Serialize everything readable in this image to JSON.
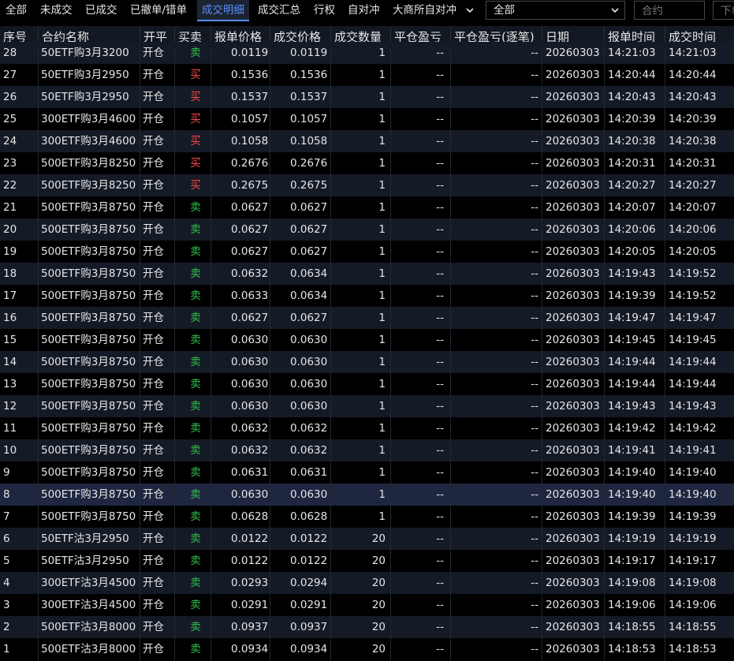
{
  "tabs": [
    {
      "label": "全部"
    },
    {
      "label": "未成交"
    },
    {
      "label": "已成交"
    },
    {
      "label": "已撤单/错单"
    },
    {
      "label": "成交明细",
      "active": true
    },
    {
      "label": "成交汇总"
    },
    {
      "label": "行权"
    },
    {
      "label": "自对冲"
    },
    {
      "label": "大商所自对冲"
    }
  ],
  "filter": {
    "selected": "全部"
  },
  "search": {
    "placeholder": "合约"
  },
  "search2": {
    "placeholder": "下单"
  },
  "columns": [
    "序号",
    "合约名称",
    "开平",
    "买卖",
    "报单价格",
    "成交价格",
    "成交数量",
    "平仓盈亏",
    "平仓盈亏(逐笔)",
    "日期",
    "报单时间",
    "成交时间"
  ],
  "colors": {
    "buy": "#ff4545",
    "sell": "#2fc24b",
    "accent": "#5b8ff9"
  },
  "rows": [
    {
      "no": "28",
      "name": "50ETF购3月3200",
      "oc": "开仓",
      "side": "卖",
      "order_price": "0.0119",
      "trade_price": "0.0119",
      "qty": "1",
      "pnl": "--",
      "pnl_each": "--",
      "date": "20260303",
      "order_time": "14:21:03",
      "trade_time": "14:21:03"
    },
    {
      "no": "27",
      "name": "50ETF购3月2950",
      "oc": "开仓",
      "side": "买",
      "order_price": "0.1536",
      "trade_price": "0.1536",
      "qty": "1",
      "pnl": "--",
      "pnl_each": "--",
      "date": "20260303",
      "order_time": "14:20:44",
      "trade_time": "14:20:44"
    },
    {
      "no": "26",
      "name": "50ETF购3月2950",
      "oc": "开仓",
      "side": "买",
      "order_price": "0.1537",
      "trade_price": "0.1537",
      "qty": "1",
      "pnl": "--",
      "pnl_each": "--",
      "date": "20260303",
      "order_time": "14:20:43",
      "trade_time": "14:20:43"
    },
    {
      "no": "25",
      "name": "300ETF购3月4600",
      "oc": "开仓",
      "side": "买",
      "order_price": "0.1057",
      "trade_price": "0.1057",
      "qty": "1",
      "pnl": "--",
      "pnl_each": "--",
      "date": "20260303",
      "order_time": "14:20:39",
      "trade_time": "14:20:39"
    },
    {
      "no": "24",
      "name": "300ETF购3月4600",
      "oc": "开仓",
      "side": "买",
      "order_price": "0.1058",
      "trade_price": "0.1058",
      "qty": "1",
      "pnl": "--",
      "pnl_each": "--",
      "date": "20260303",
      "order_time": "14:20:38",
      "trade_time": "14:20:38"
    },
    {
      "no": "23",
      "name": "500ETF购3月8250",
      "oc": "开仓",
      "side": "买",
      "order_price": "0.2676",
      "trade_price": "0.2676",
      "qty": "1",
      "pnl": "--",
      "pnl_each": "--",
      "date": "20260303",
      "order_time": "14:20:31",
      "trade_time": "14:20:31"
    },
    {
      "no": "22",
      "name": "500ETF购3月8250",
      "oc": "开仓",
      "side": "买",
      "order_price": "0.2675",
      "trade_price": "0.2675",
      "qty": "1",
      "pnl": "--",
      "pnl_each": "--",
      "date": "20260303",
      "order_time": "14:20:27",
      "trade_time": "14:20:27"
    },
    {
      "no": "21",
      "name": "500ETF购3月8750",
      "oc": "开仓",
      "side": "卖",
      "order_price": "0.0627",
      "trade_price": "0.0627",
      "qty": "1",
      "pnl": "--",
      "pnl_each": "--",
      "date": "20260303",
      "order_time": "14:20:07",
      "trade_time": "14:20:07"
    },
    {
      "no": "20",
      "name": "500ETF购3月8750",
      "oc": "开仓",
      "side": "卖",
      "order_price": "0.0627",
      "trade_price": "0.0627",
      "qty": "1",
      "pnl": "--",
      "pnl_each": "--",
      "date": "20260303",
      "order_time": "14:20:06",
      "trade_time": "14:20:06"
    },
    {
      "no": "19",
      "name": "500ETF购3月8750",
      "oc": "开仓",
      "side": "卖",
      "order_price": "0.0627",
      "trade_price": "0.0627",
      "qty": "1",
      "pnl": "--",
      "pnl_each": "--",
      "date": "20260303",
      "order_time": "14:20:05",
      "trade_time": "14:20:05"
    },
    {
      "no": "18",
      "name": "500ETF购3月8750",
      "oc": "开仓",
      "side": "卖",
      "order_price": "0.0632",
      "trade_price": "0.0634",
      "qty": "1",
      "pnl": "--",
      "pnl_each": "--",
      "date": "20260303",
      "order_time": "14:19:43",
      "trade_time": "14:19:52"
    },
    {
      "no": "17",
      "name": "500ETF购3月8750",
      "oc": "开仓",
      "side": "卖",
      "order_price": "0.0633",
      "trade_price": "0.0634",
      "qty": "1",
      "pnl": "--",
      "pnl_each": "--",
      "date": "20260303",
      "order_time": "14:19:39",
      "trade_time": "14:19:52"
    },
    {
      "no": "16",
      "name": "500ETF购3月8750",
      "oc": "开仓",
      "side": "卖",
      "order_price": "0.0627",
      "trade_price": "0.0627",
      "qty": "1",
      "pnl": "--",
      "pnl_each": "--",
      "date": "20260303",
      "order_time": "14:19:47",
      "trade_time": "14:19:47"
    },
    {
      "no": "15",
      "name": "500ETF购3月8750",
      "oc": "开仓",
      "side": "卖",
      "order_price": "0.0630",
      "trade_price": "0.0630",
      "qty": "1",
      "pnl": "--",
      "pnl_each": "--",
      "date": "20260303",
      "order_time": "14:19:45",
      "trade_time": "14:19:45"
    },
    {
      "no": "14",
      "name": "500ETF购3月8750",
      "oc": "开仓",
      "side": "卖",
      "order_price": "0.0630",
      "trade_price": "0.0630",
      "qty": "1",
      "pnl": "--",
      "pnl_each": "--",
      "date": "20260303",
      "order_time": "14:19:44",
      "trade_time": "14:19:44"
    },
    {
      "no": "13",
      "name": "500ETF购3月8750",
      "oc": "开仓",
      "side": "卖",
      "order_price": "0.0630",
      "trade_price": "0.0630",
      "qty": "1",
      "pnl": "--",
      "pnl_each": "--",
      "date": "20260303",
      "order_time": "14:19:44",
      "trade_time": "14:19:44"
    },
    {
      "no": "12",
      "name": "500ETF购3月8750",
      "oc": "开仓",
      "side": "卖",
      "order_price": "0.0630",
      "trade_price": "0.0630",
      "qty": "1",
      "pnl": "--",
      "pnl_each": "--",
      "date": "20260303",
      "order_time": "14:19:43",
      "trade_time": "14:19:43"
    },
    {
      "no": "11",
      "name": "500ETF购3月8750",
      "oc": "开仓",
      "side": "卖",
      "order_price": "0.0632",
      "trade_price": "0.0632",
      "qty": "1",
      "pnl": "--",
      "pnl_each": "--",
      "date": "20260303",
      "order_time": "14:19:42",
      "trade_time": "14:19:42"
    },
    {
      "no": "10",
      "name": "500ETF购3月8750",
      "oc": "开仓",
      "side": "卖",
      "order_price": "0.0632",
      "trade_price": "0.0632",
      "qty": "1",
      "pnl": "--",
      "pnl_each": "--",
      "date": "20260303",
      "order_time": "14:19:41",
      "trade_time": "14:19:41"
    },
    {
      "no": "9",
      "name": "500ETF购3月8750",
      "oc": "开仓",
      "side": "卖",
      "order_price": "0.0631",
      "trade_price": "0.0631",
      "qty": "1",
      "pnl": "--",
      "pnl_each": "--",
      "date": "20260303",
      "order_time": "14:19:40",
      "trade_time": "14:19:40"
    },
    {
      "no": "8",
      "name": "500ETF购3月8750",
      "oc": "开仓",
      "side": "卖",
      "order_price": "0.0630",
      "trade_price": "0.0630",
      "qty": "1",
      "pnl": "--",
      "pnl_each": "--",
      "date": "20260303",
      "order_time": "14:19:40",
      "trade_time": "14:19:40",
      "selected": true
    },
    {
      "no": "7",
      "name": "500ETF购3月8750",
      "oc": "开仓",
      "side": "卖",
      "order_price": "0.0628",
      "trade_price": "0.0628",
      "qty": "1",
      "pnl": "--",
      "pnl_each": "--",
      "date": "20260303",
      "order_time": "14:19:39",
      "trade_time": "14:19:39"
    },
    {
      "no": "6",
      "name": "50ETF沽3月2950",
      "oc": "开仓",
      "side": "卖",
      "order_price": "0.0122",
      "trade_price": "0.0122",
      "qty": "20",
      "pnl": "--",
      "pnl_each": "--",
      "date": "20260303",
      "order_time": "14:19:19",
      "trade_time": "14:19:19"
    },
    {
      "no": "5",
      "name": "50ETF沽3月2950",
      "oc": "开仓",
      "side": "卖",
      "order_price": "0.0122",
      "trade_price": "0.0122",
      "qty": "20",
      "pnl": "--",
      "pnl_each": "--",
      "date": "20260303",
      "order_time": "14:19:17",
      "trade_time": "14:19:17"
    },
    {
      "no": "4",
      "name": "300ETF沽3月4500",
      "oc": "开仓",
      "side": "卖",
      "order_price": "0.0293",
      "trade_price": "0.0294",
      "qty": "20",
      "pnl": "--",
      "pnl_each": "--",
      "date": "20260303",
      "order_time": "14:19:08",
      "trade_time": "14:19:08"
    },
    {
      "no": "3",
      "name": "300ETF沽3月4500",
      "oc": "开仓",
      "side": "卖",
      "order_price": "0.0291",
      "trade_price": "0.0291",
      "qty": "20",
      "pnl": "--",
      "pnl_each": "--",
      "date": "20260303",
      "order_time": "14:19:06",
      "trade_time": "14:19:06"
    },
    {
      "no": "2",
      "name": "500ETF沽3月8000",
      "oc": "开仓",
      "side": "卖",
      "order_price": "0.0937",
      "trade_price": "0.0937",
      "qty": "20",
      "pnl": "--",
      "pnl_each": "--",
      "date": "20260303",
      "order_time": "14:18:55",
      "trade_time": "14:18:55"
    },
    {
      "no": "1",
      "name": "500ETF沽3月8000",
      "oc": "开仓",
      "side": "卖",
      "order_price": "0.0934",
      "trade_price": "0.0934",
      "qty": "20",
      "pnl": "--",
      "pnl_each": "--",
      "date": "20260303",
      "order_time": "14:18:53",
      "trade_time": "14:18:53"
    }
  ]
}
